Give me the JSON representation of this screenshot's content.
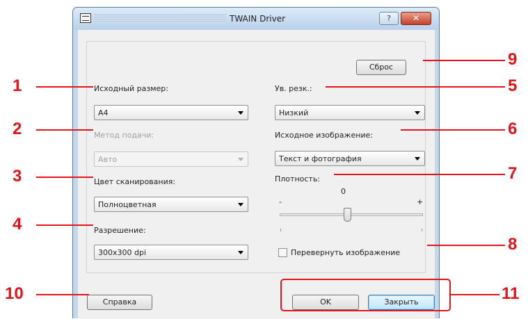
{
  "window": {
    "title": "TWAIN Driver",
    "help_glyph": "?",
    "close_glyph": "✕"
  },
  "buttons": {
    "reset": "Сброс",
    "help": "Справка",
    "ok": "OK",
    "close": "Закрыть"
  },
  "fields": {
    "original_size": {
      "label": "Исходный размер:",
      "value": "A4"
    },
    "feed_method": {
      "label": "Метод подачи:",
      "value": "Авто"
    },
    "scan_color": {
      "label": "Цвет сканирования:",
      "value": "Полноцветная"
    },
    "resolution": {
      "label": "Разрешение:",
      "value": "300x300 dpi"
    },
    "sharpness": {
      "label": "Ув. резк.:",
      "value": "Низкий"
    },
    "original_image": {
      "label": "Исходное изображение:",
      "value": "Текст и фотография"
    }
  },
  "density": {
    "label": "Плотность:",
    "value": "0",
    "min_label": "-",
    "max_label": "+",
    "level": 0
  },
  "invert": {
    "label": "Перевернуть изображение",
    "checked": false
  },
  "callouts": [
    "1",
    "2",
    "3",
    "4",
    "5",
    "6",
    "7",
    "8",
    "9",
    "10",
    "11"
  ],
  "colors": {
    "callout": "#e3121b",
    "window_frame": "#c4d8ec",
    "client": "#f0f0f0"
  }
}
